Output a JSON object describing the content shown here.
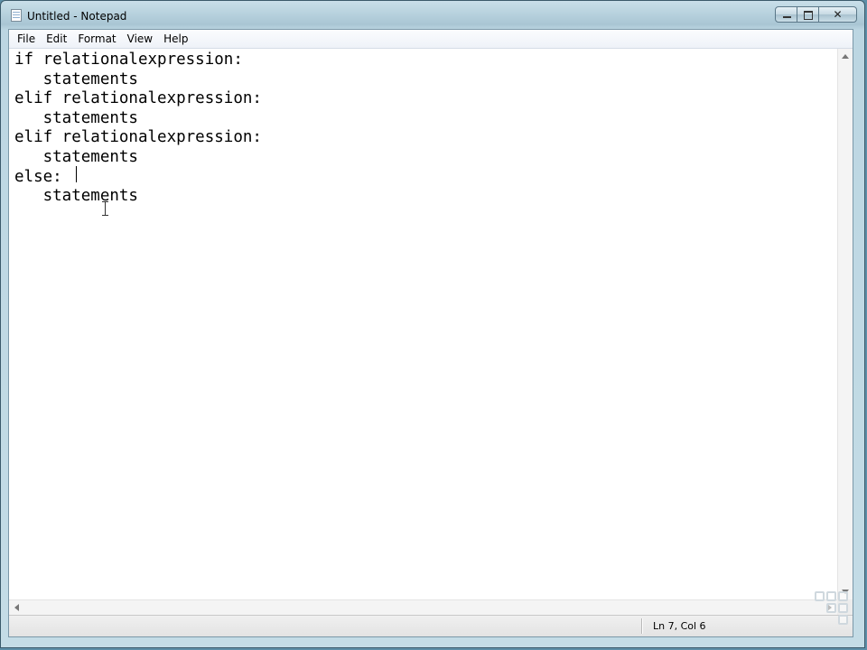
{
  "window": {
    "title": "Untitled - Notepad"
  },
  "caption": {
    "minimize_icon": "minimize-icon",
    "maximize_icon": "maximize-icon",
    "close_icon": "close-icon",
    "close_glyph": "✕"
  },
  "menubar": {
    "items": [
      "File",
      "Edit",
      "Format",
      "View",
      "Help"
    ]
  },
  "editor": {
    "lines": [
      "if relationalexpression:",
      "   statements",
      "elif relationalexpression:",
      "   statements",
      "elif relationalexpression:",
      "   statements",
      "else:",
      "   statements"
    ]
  },
  "statusbar": {
    "position": "Ln 7, Col 6"
  },
  "colors": {
    "window_frame": "#a9c6d4",
    "desktop": "#5d8fa8",
    "editor_bg": "#ffffff"
  }
}
